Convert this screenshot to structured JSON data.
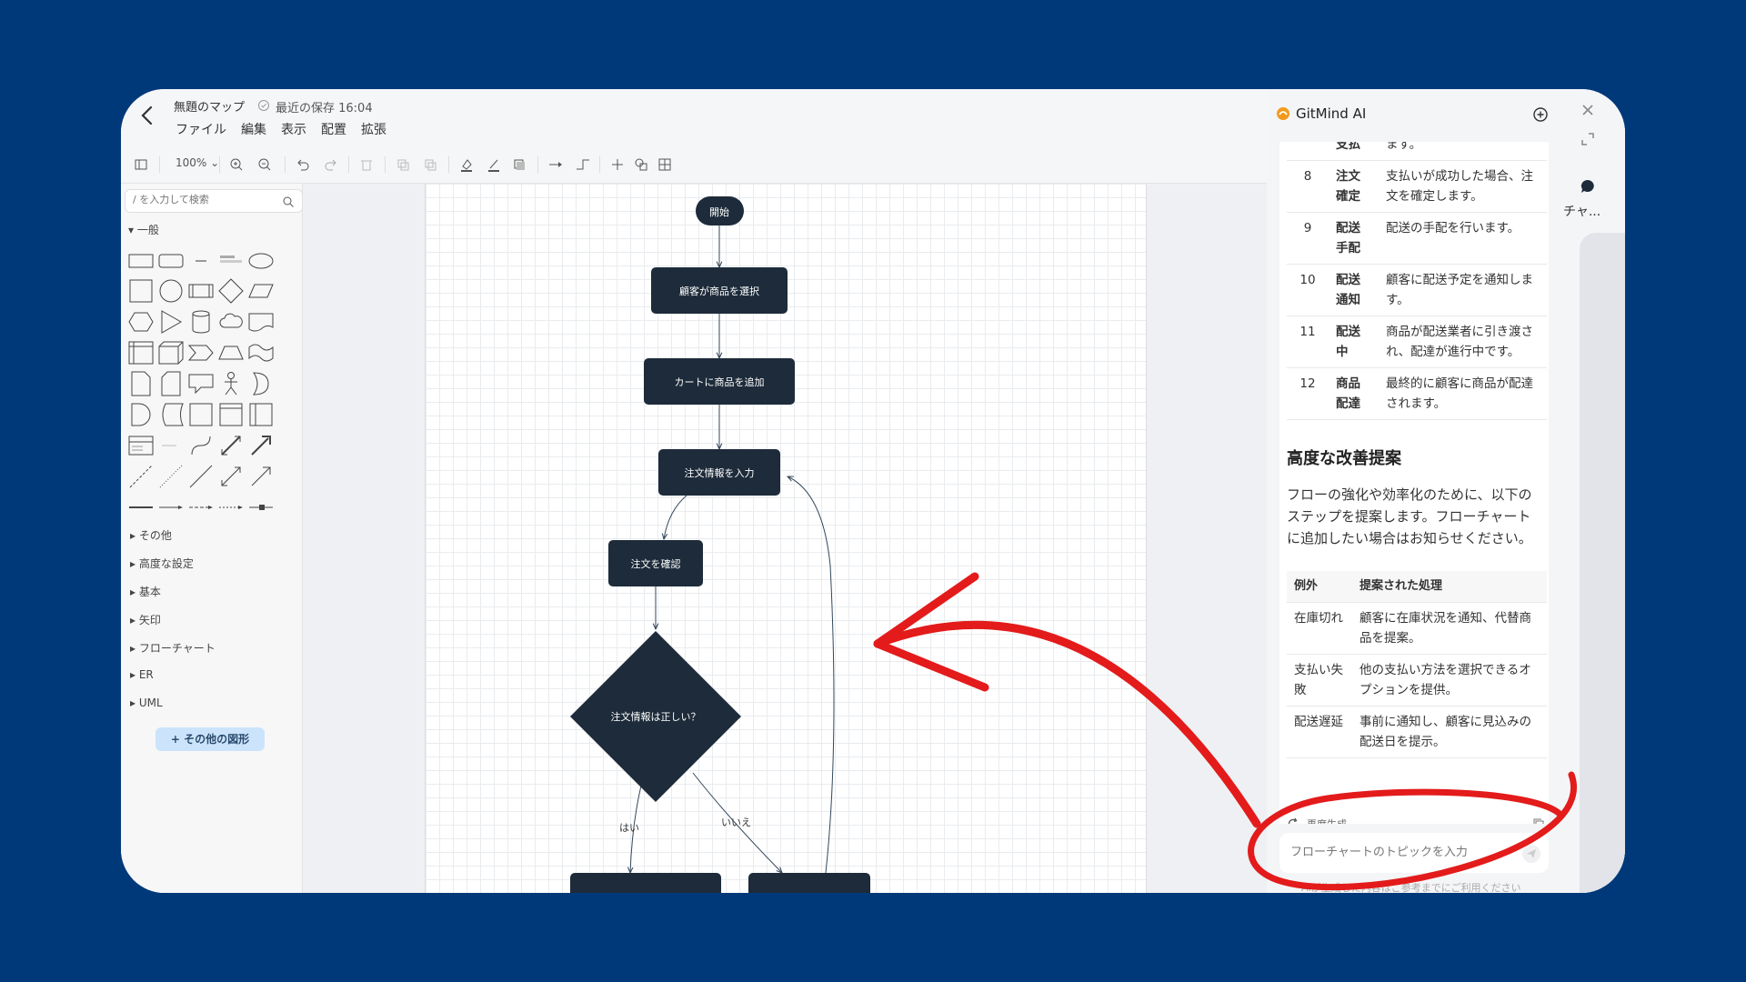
{
  "header": {
    "title": "無題のマップ",
    "save_status": "最近の保存 16:04",
    "menu": [
      "ファイル",
      "編集",
      "表示",
      "配置",
      "拡張"
    ]
  },
  "toolbar": {
    "zoom": "100%"
  },
  "left_panel": {
    "search_placeholder": "/ を入力して検索",
    "general": "一般",
    "categories": [
      "その他",
      "高度な設定",
      "基本",
      "矢印",
      "フローチャート",
      "ER",
      "UML"
    ],
    "more_shapes": "+ その他の図形"
  },
  "flowchart": {
    "nodes": [
      "開始",
      "顧客が商品を選択",
      "カートに商品を追加",
      "注文情報を入力",
      "注文を確認",
      "注文情報は正しい？"
    ],
    "edge_labels": [
      "はい",
      "いいえ"
    ]
  },
  "ai_panel": {
    "title": "GitMind AI",
    "steps": [
      {
        "num": "",
        "name": "支払",
        "desc": "ます。"
      },
      {
        "num": "8",
        "name": "注文確定",
        "desc": "支払いが成功した場合、注文を確定します。"
      },
      {
        "num": "9",
        "name": "配送手配",
        "desc": "配送の手配を行います。"
      },
      {
        "num": "10",
        "name": "配送通知",
        "desc": "顧客に配送予定を通知します。"
      },
      {
        "num": "11",
        "name": "配送中",
        "desc": "商品が配送業者に引き渡され、配達が進行中です。"
      },
      {
        "num": "12",
        "name": "商品配達",
        "desc": "最終的に顧客に商品が配達されます。"
      }
    ],
    "advanced_title": "高度な改善提案",
    "advanced_body": "フローの強化や効率化のために、以下のステップを提案します。フローチャートに追加したい場合はお知らせください。",
    "exceptions_header": [
      "例外",
      "提案された処理"
    ],
    "exceptions": [
      {
        "name": "在庫切れ",
        "action": "顧客に在庫状況を通知、代替商品を提案。"
      },
      {
        "name": "支払い失敗",
        "action": "他の支払い方法を選択できるオプションを提供。"
      },
      {
        "name": "配送遅延",
        "action": "事前に通知し、顧客に見込みの配送日を提示。"
      }
    ],
    "regenerate": "再度生成",
    "input_placeholder": "フローチャートのトピックを入力",
    "disclaimer": "AIが生成した内容はご参考までにご利用ください"
  },
  "rail": {
    "chat_label": "チャ..."
  },
  "colors": {
    "background": "#00397a",
    "node": "#1d2b3a",
    "annotation": "#e31b1b"
  }
}
